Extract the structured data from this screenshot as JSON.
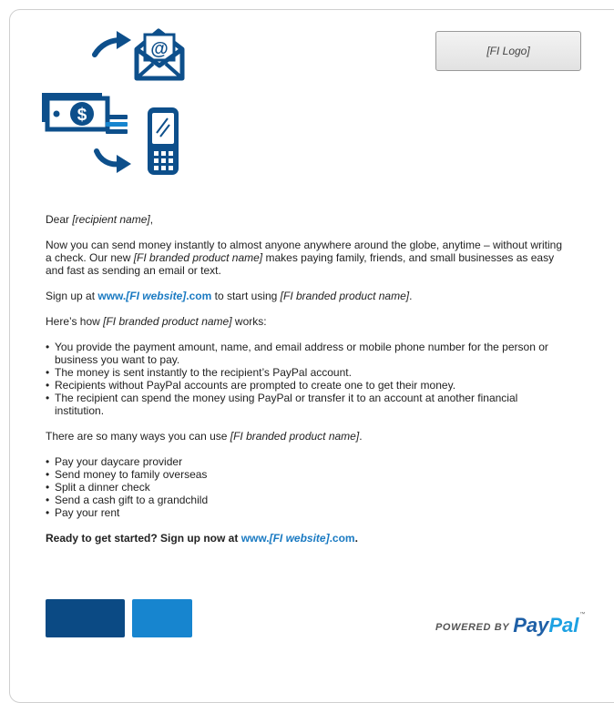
{
  "header": {
    "logo_placeholder": "[FI Logo]"
  },
  "letter": {
    "salutation_prefix": "Dear ",
    "recipient": "[recipient name]",
    "salutation_suffix": ",",
    "intro_1": "Now you can send money instantly to almost anyone anywhere around the globe, anytime – without writing a check. Our new ",
    "product_name": "[FI branded product name]",
    "intro_2": " makes paying family, friends, and small businesses as easy and fast as sending an email or text.",
    "signup_prefix": "Sign up at ",
    "website_prefix": "www.",
    "website_name": "[FI website]",
    "website_suffix": ".com",
    "signup_middle": " to start using ",
    "signup_suffix": ".",
    "how_prefix": "Here’s how ",
    "how_suffix": " works:",
    "how_steps": [
      "You provide the payment amount, name, and email address or mobile phone number for the person or business you want to pay.",
      "The money is sent instantly to the recipient’s PayPal account.",
      "Recipients without PayPal accounts are prompted to create one to get their money.",
      "The recipient can spend the money using PayPal or transfer it to an account at another financial institution."
    ],
    "ways_prefix": "There are so many ways you can use ",
    "ways_suffix": ".",
    "ways": [
      "Pay your daycare provider",
      "Send money to family overseas",
      "Split a dinner check",
      "Send a cash gift to a grandchild",
      "Pay your rent"
    ],
    "cta_prefix": "Ready to get started? Sign up now at ",
    "cta_suffix": "."
  },
  "footer": {
    "powered_by": "POWERED BY",
    "paypal_pay": "Pay",
    "paypal_pal": "Pal",
    "trademark": "™"
  },
  "colors": {
    "icon_blue": "#0d4f8b",
    "accent_blue": "#1a7ac2",
    "button_dark": "#0b4a84",
    "button_light": "#1785cf",
    "paypal_dark": "#1e5fa6",
    "paypal_light": "#1da1e2"
  },
  "icons": [
    "arrow-icon",
    "email-icon",
    "money-icon",
    "mobile-phone-icon"
  ]
}
